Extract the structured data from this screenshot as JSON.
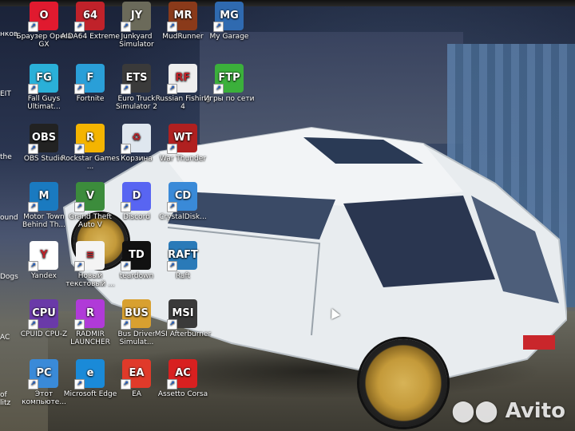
{
  "desktop": {
    "left_cut_labels": [
      "нков",
      "EIT",
      "the",
      "ound",
      "Dogs",
      "AC",
      "of",
      "litz"
    ],
    "icons": [
      {
        "id": "opera-gx",
        "label": "Браузер Opera GX",
        "glyph": "O",
        "bg": "#e01a2f"
      },
      {
        "id": "aida64",
        "label": "AIDA64 Extreme",
        "glyph": "64",
        "bg": "#c0222a"
      },
      {
        "id": "junkyard",
        "label": "Junkyard Simulator",
        "glyph": "JY",
        "bg": "#6b6a5a"
      },
      {
        "id": "mudrunner",
        "label": "MudRunner",
        "glyph": "MR",
        "bg": "#8a3a1a"
      },
      {
        "id": "my-garage",
        "label": "My Garage",
        "glyph": "MG",
        "bg": "#2f6ab0"
      },
      {
        "id": "fall-guys",
        "label": "Fall Guys Ultimat...",
        "glyph": "FG",
        "bg": "#2ab0d8"
      },
      {
        "id": "fortnite",
        "label": "Fortnite",
        "glyph": "F",
        "bg": "#2a9fd8"
      },
      {
        "id": "euro-truck",
        "label": "Euro Truck Simulator 2",
        "glyph": "ETS",
        "bg": "#3a3a3a"
      },
      {
        "id": "russian-fishing",
        "label": "Russian Fishing 4",
        "glyph": "RF",
        "bg": "#eeeeee"
      },
      {
        "id": "ftp",
        "label": "Игры по сети",
        "glyph": "FTP",
        "bg": "#3bb03b"
      },
      {
        "id": "obs",
        "label": "OBS Studio",
        "glyph": "OBS",
        "bg": "#222222"
      },
      {
        "id": "rockstar",
        "label": "Rockstar Games ...",
        "glyph": "R",
        "bg": "#f4b400"
      },
      {
        "id": "recycle",
        "label": "Корзина",
        "glyph": "♻",
        "bg": "#dfe7ef"
      },
      {
        "id": "war-thunder",
        "label": "War Thunder",
        "glyph": "WT",
        "bg": "#b02020"
      },
      {
        "id": "motortown",
        "label": "Motor Town Behind Th...",
        "glyph": "M",
        "bg": "#1a7ac0"
      },
      {
        "id": "gta5",
        "label": "Grand Theft Auto V",
        "glyph": "V",
        "bg": "#3c8c3c"
      },
      {
        "id": "discord",
        "label": "Discord",
        "glyph": "D",
        "bg": "#5865f2"
      },
      {
        "id": "crystaldisk",
        "label": "CrystalDisk...",
        "glyph": "CD",
        "bg": "#3a8ad8"
      },
      {
        "id": "yandex",
        "label": "Yandex",
        "glyph": "Y",
        "bg": "#ffffff"
      },
      {
        "id": "new-doc",
        "label": "Новый текстовый ...",
        "glyph": "≡",
        "bg": "#f4f4f4"
      },
      {
        "id": "teardown",
        "label": "teardown",
        "glyph": "TD",
        "bg": "#111111"
      },
      {
        "id": "raft",
        "label": "Raft",
        "glyph": "RAFT",
        "bg": "#2a7ab8"
      },
      {
        "id": "cpuid",
        "label": "CPUID CPU-Z",
        "glyph": "CPU",
        "bg": "#6a3aa8"
      },
      {
        "id": "radmir",
        "label": "RADMIR LAUNCHER",
        "glyph": "R",
        "bg": "#b03ad8"
      },
      {
        "id": "bus-driver",
        "label": "Bus Driver Simulat...",
        "glyph": "BUS",
        "bg": "#d8a030"
      },
      {
        "id": "msi",
        "label": "MSI Afterburner",
        "glyph": "MSI",
        "bg": "#3a3a3a"
      },
      {
        "id": "this-pc",
        "label": "Этот компьюте...",
        "glyph": "PC",
        "bg": "#3a8ad8"
      },
      {
        "id": "edge",
        "label": "Microsoft Edge",
        "glyph": "e",
        "bg": "#1a8ad8"
      },
      {
        "id": "ea",
        "label": "EA",
        "glyph": "EA",
        "bg": "#e03a2a"
      },
      {
        "id": "assetto",
        "label": "Assetto Corsa",
        "glyph": "AC",
        "bg": "#d82020"
      }
    ]
  },
  "watermark": {
    "text": "Avito"
  }
}
